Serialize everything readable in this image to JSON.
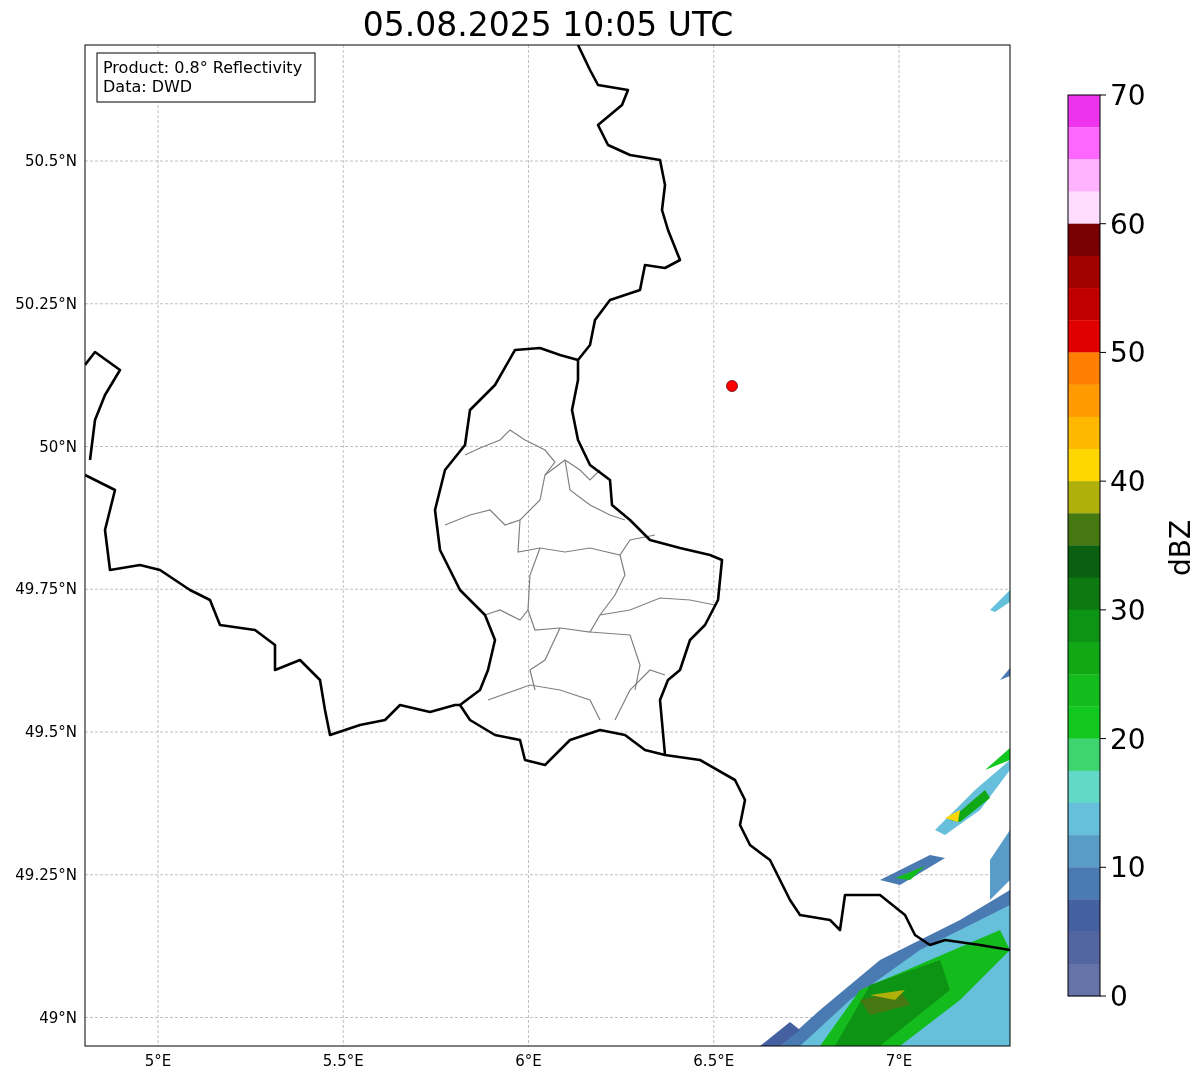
{
  "title": "05.08.2025 10:05 UTC",
  "info_box": {
    "lines": [
      "Product: 0.8° Reflectivity",
      "Data: DWD"
    ]
  },
  "map": {
    "lat_labels": [
      "50.5°N",
      "50.25°N",
      "50°N",
      "49.75°N",
      "49.5°N",
      "49.25°N",
      "49°N"
    ],
    "lon_labels": [
      "5°E",
      "5.5°E",
      "6°E",
      "6.5°E",
      "7°E"
    ]
  },
  "colorbar": {
    "label": "dBZ",
    "ticks": [
      "70",
      "60",
      "50",
      "40",
      "30",
      "20",
      "10",
      "0"
    ],
    "bins": [
      {
        "color": "#ee33ee"
      },
      {
        "color": "#ff66ff"
      },
      {
        "color": "#ffb3ff"
      },
      {
        "color": "#ffddff"
      },
      {
        "color": "#780000"
      },
      {
        "color": "#a00000"
      },
      {
        "color": "#c00000"
      },
      {
        "color": "#e00000"
      },
      {
        "color": "#ff7f00"
      },
      {
        "color": "#ff9b00"
      },
      {
        "color": "#ffb800"
      },
      {
        "color": "#ffd700"
      },
      {
        "color": "#b0b00a"
      },
      {
        "color": "#457810"
      },
      {
        "color": "#0a6010"
      },
      {
        "color": "#0c7a10"
      },
      {
        "color": "#0e9414"
      },
      {
        "color": "#10a814"
      },
      {
        "color": "#14bb1c"
      },
      {
        "color": "#12c81e"
      },
      {
        "color": "#3ed46e"
      },
      {
        "color": "#62d8c8"
      },
      {
        "color": "#66c0dc"
      },
      {
        "color": "#5a9cc8"
      },
      {
        "color": "#4a7ab2"
      },
      {
        "color": "#4560a0"
      },
      {
        "color": "#5366a0"
      },
      {
        "color": "#6673a8"
      }
    ]
  }
}
